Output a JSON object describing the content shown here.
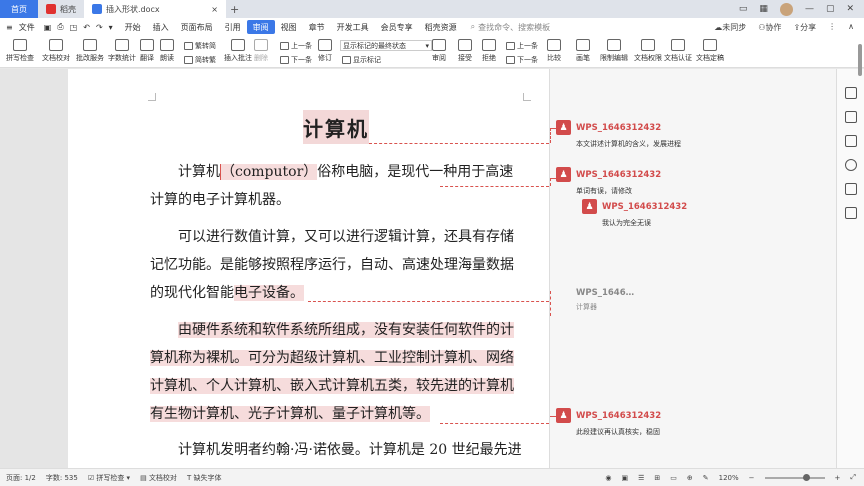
{
  "titlebar": {
    "home": "首页",
    "tabs": [
      {
        "label": "稻壳",
        "color": "#e0312f"
      },
      {
        "label": "插入形状.docx",
        "color": "#3b78e7"
      }
    ],
    "new_tab": "+",
    "sign_in": "未同步",
    "collab": "协作",
    "share": "分享"
  },
  "menubar": {
    "file": "文件",
    "items": [
      "开始",
      "插入",
      "页面布局",
      "引用",
      "审阅",
      "视图",
      "章节",
      "开发工具",
      "会员专享",
      "稻壳资源"
    ],
    "active": "审阅",
    "search": "查找命令、搜索模板"
  },
  "toolbar": {
    "spellcheck": "拼写检查",
    "doc_proof": "文档校对",
    "batch": "批改服务",
    "translate_chs": "繁转简",
    "simp_to_trad": "简转繁",
    "read": "朗读",
    "translate": "翻译",
    "word_count": "字数统计",
    "insert_comment": "插入批注",
    "delete": "删除",
    "prev": "上一条",
    "next": "下一条",
    "revise": "修订",
    "dropdown": "显示标记的最终状态",
    "show_marks": "显示标记",
    "review": "审阅",
    "accept": "接受",
    "reject": "拒绝",
    "prev2": "上一条",
    "next2": "下一条",
    "compare": "比较",
    "brush": "画笔",
    "limit_edit": "限制编辑",
    "doc_perm": "文档权限",
    "doc_cert": "文档认证",
    "doc_final": "文档定稿"
  },
  "document": {
    "title": "计算机",
    "p1_a": "计算机",
    "p1_hl": "（computor）",
    "p1_b": "俗称电脑，是现代一种用于高速计算的电子计算机器。",
    "p2_a": "可以进行数值计算，又可以进行逻辑计算，还具有存储记忆功能。是能够按照程序运行，自动、高速处理海量数据的现代化智能",
    "p2_hl": "电子设备。",
    "p3": "由硬件系统和软件系统所组成，没有安装任何软件的计算机称为裸机。可分为超级计算机、工业控制计算机、网络计算机、个人计算机、嵌入式计算机五类，较先进的计算机有生物计算机、光子计算机、量子计算机等。",
    "p4": "计算机发明者约翰·冯·诺依曼。计算机是 20 世纪最先进"
  },
  "comments": [
    {
      "author": "WPS_1646312432",
      "text": "本文讲述计算机的含义，发展进程"
    },
    {
      "author": "WPS_1646312432",
      "text": "单词有误，请修改"
    },
    {
      "author": "WPS_1646312432",
      "text": "我认为完全无误"
    },
    {
      "author": "WPS_1646…",
      "text": "计算器"
    },
    {
      "author": "WPS_1646312432",
      "text": "此段建议再认真核实，稳固"
    }
  ],
  "statusbar": {
    "page": "页面: 1/2",
    "words": "字数: 535",
    "spell": "拼写检查",
    "proof": "文档校对",
    "font_missing": "缺失字体",
    "zoom": "120%"
  }
}
